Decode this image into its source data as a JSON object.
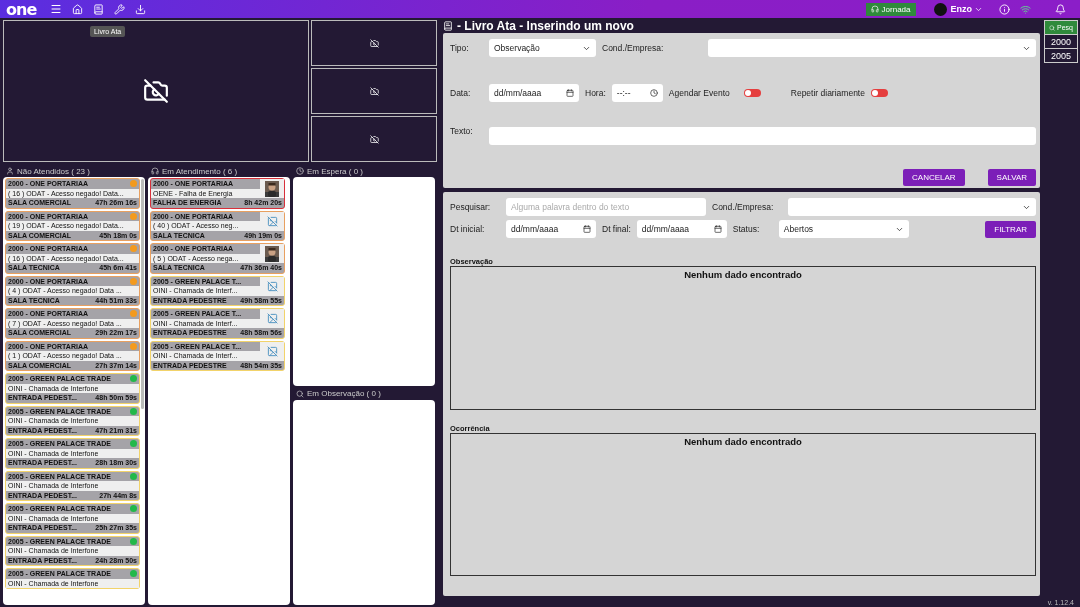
{
  "topbar": {
    "logo": "one",
    "tooltip": "Livro Ata",
    "jornada": "Jornada",
    "user": "Enzo"
  },
  "queues": [
    {
      "title": "Não Atendidos ( 23 )",
      "cards": [
        {
          "title": "2000 - ONE PORTARIAA",
          "subtitle": "( 16 ) ODAT - Acesso negado! Data...",
          "location": "SALA COMERCIAL",
          "time": "47h 26m 16s",
          "color": "#e8a060",
          "dot": {
            "color": "#f39a1e"
          }
        },
        {
          "title": "2000 - ONE PORTARIAA",
          "subtitle": "( 19 ) ODAT - Acesso negado! Data...",
          "location": "SALA COMERCIAL",
          "time": "45h 18m 0s",
          "color": "#e8a060",
          "dot": {
            "color": "#f39a1e"
          }
        },
        {
          "title": "2000 - ONE PORTARIAA",
          "subtitle": "( 16 ) ODAT - Acesso negado! Data...",
          "location": "SALA TECNICA",
          "time": "45h 6m 41s",
          "color": "#e8a060",
          "dot": {
            "color": "#f39a1e"
          }
        },
        {
          "title": "2000 - ONE PORTARIAA",
          "subtitle": "( 4 ) ODAT - Acesso negado! Data ...",
          "location": "SALA TECNICA",
          "time": "44h 51m 33s",
          "color": "#e8a060",
          "dot": {
            "color": "#f39a1e"
          }
        },
        {
          "title": "2000 - ONE PORTARIAA",
          "subtitle": "( 7 ) ODAT - Acesso negado! Data ...",
          "location": "SALA COMERCIAL",
          "time": "29h 22m 17s",
          "color": "#e8a060",
          "dot": {
            "color": "#f39a1e"
          }
        },
        {
          "title": "2000 - ONE PORTARIAA",
          "subtitle": "( 1 ) ODAT - Acesso negado! Data ...",
          "location": "SALA COMERCIAL",
          "time": "27h 37m 14s",
          "color": "#e8a060",
          "dot": {
            "color": "#f39a1e"
          }
        },
        {
          "title": "2005 - GREEN PALACE TRADE",
          "subtitle": "OINI - Chamada de Interfone",
          "location": "ENTRADA PEDEST...",
          "time": "48h 50m 59s",
          "color": "#f2d36a",
          "dot": {
            "color": "#22b84a"
          }
        },
        {
          "title": "2005 - GREEN PALACE TRADE",
          "subtitle": "OINI - Chamada de Interfone",
          "location": "ENTRADA PEDEST...",
          "time": "47h 21m 31s",
          "color": "#f2d36a",
          "dot": {
            "color": "#22b84a"
          }
        },
        {
          "title": "2005 - GREEN PALACE TRADE",
          "subtitle": "OINI - Chamada de Interfone",
          "location": "ENTRADA PEDEST...",
          "time": "28h 18m 30s",
          "color": "#f2d36a",
          "dot": {
            "color": "#22b84a"
          }
        },
        {
          "title": "2005 - GREEN PALACE TRADE",
          "subtitle": "OINI - Chamada de Interfone",
          "location": "ENTRADA PEDEST...",
          "time": "27h 44m 8s",
          "color": "#f2d36a",
          "dot": {
            "color": "#22b84a"
          }
        },
        {
          "title": "2005 - GREEN PALACE TRADE",
          "subtitle": "OINI - Chamada de Interfone",
          "location": "ENTRADA PEDEST...",
          "time": "25h 27m 35s",
          "color": "#f2d36a",
          "dot": {
            "color": "#22b84a"
          }
        },
        {
          "title": "2005 - GREEN PALACE TRADE",
          "subtitle": "OINI - Chamada de Interfone",
          "location": "ENTRADA PEDEST...",
          "time": "24h 28m 50s",
          "color": "#f2d36a",
          "dot": {
            "color": "#22b84a"
          }
        },
        {
          "title": "2005 - GREEN PALACE TRADE",
          "subtitle": "OINI - Chamada de Interfone",
          "color": "#f2d36a",
          "dot": {
            "color": "#22b84a"
          }
        }
      ]
    },
    {
      "title": "Em Atendimento ( 6 )",
      "cards": [
        {
          "title": "2000 - ONE PORTARIAA",
          "subtitle": "OENE - Falha de Energia",
          "location": "FALHA DE ENERGIA",
          "time": "8h 42m 20s",
          "color": "#d8303a"
        },
        {
          "title": "2000 - ONE PORTARIAA",
          "subtitle": "( 40 ) ODAT - Acesso neg...",
          "location": "SALA TECNICA",
          "time": "49h 19m 0s",
          "color": "#e8a060",
          "kind": "broken"
        },
        {
          "title": "2000 - ONE PORTARIAA",
          "subtitle": "( 5 ) ODAT - Acesso nega...",
          "location": "SALA TECNICA",
          "time": "47h 36m 40s",
          "color": "#e8a060"
        },
        {
          "title": "2005 - GREEN PALACE T...",
          "subtitle": "OINI - Chamada de Interf...",
          "location": "ENTRADA PEDESTRE",
          "time": "49h 58m 55s",
          "color": "#f2d36a",
          "kind": "broken"
        },
        {
          "title": "2005 - GREEN PALACE T...",
          "subtitle": "OINI - Chamada de Interf...",
          "location": "ENTRADA PEDESTRE",
          "time": "48h 58m 56s",
          "color": "#f2d36a",
          "kind": "broken"
        },
        {
          "title": "2005 - GREEN PALACE T...",
          "subtitle": "OINI - Chamada de Interf...",
          "location": "ENTRADA PEDESTRE",
          "time": "48h 54m 35s",
          "color": "#f2d36a",
          "kind": "broken"
        }
      ]
    },
    {
      "title": "Em Espera ( 0 )"
    },
    {
      "title": "Em Observação ( 0 )"
    }
  ],
  "form": {
    "title": "- Livro Ata - Inserindo um novo",
    "tipo": {
      "label": "Tipo:",
      "value": "Observação"
    },
    "empresa": {
      "label": "Cond./Empresa:"
    },
    "data": {
      "label": "Data:",
      "placeholder": "dd/mm/aaaa"
    },
    "hora": {
      "label": "Hora:",
      "placeholder": "--:--"
    },
    "toggles": [
      {
        "label": "Agendar Evento",
        "on": false
      },
      {
        "label": "Repetir diariamente",
        "on": false
      }
    ],
    "texto": {
      "label": "Texto:"
    },
    "buttons": [
      "CANCELAR",
      "SALVAR"
    ]
  },
  "search": {
    "pesquisar": {
      "label": "Pesquisar:",
      "placeholder": "Alguma palavra dentro do texto"
    },
    "empresa": {
      "label": "Cond./Empresa:"
    },
    "dt_inicial": {
      "label": "Dt inicial:",
      "placeholder": "dd/mm/aaaa"
    },
    "dt_final": {
      "label": "Dt final:",
      "placeholder": "dd/mm/aaaa"
    },
    "status": {
      "label": "Status:",
      "value": "Abertos"
    },
    "button": "FILTRAR",
    "sections": [
      {
        "title": "Observação",
        "empty_text": "Nenhum dado encontrado"
      },
      {
        "title": "Ocorrência",
        "empty_text": "Nenhum dado encontrado"
      }
    ]
  },
  "sidebar": {
    "search_button": "Pesq",
    "items": [
      "2000",
      "2005"
    ]
  },
  "version": "v. 1.12.4"
}
